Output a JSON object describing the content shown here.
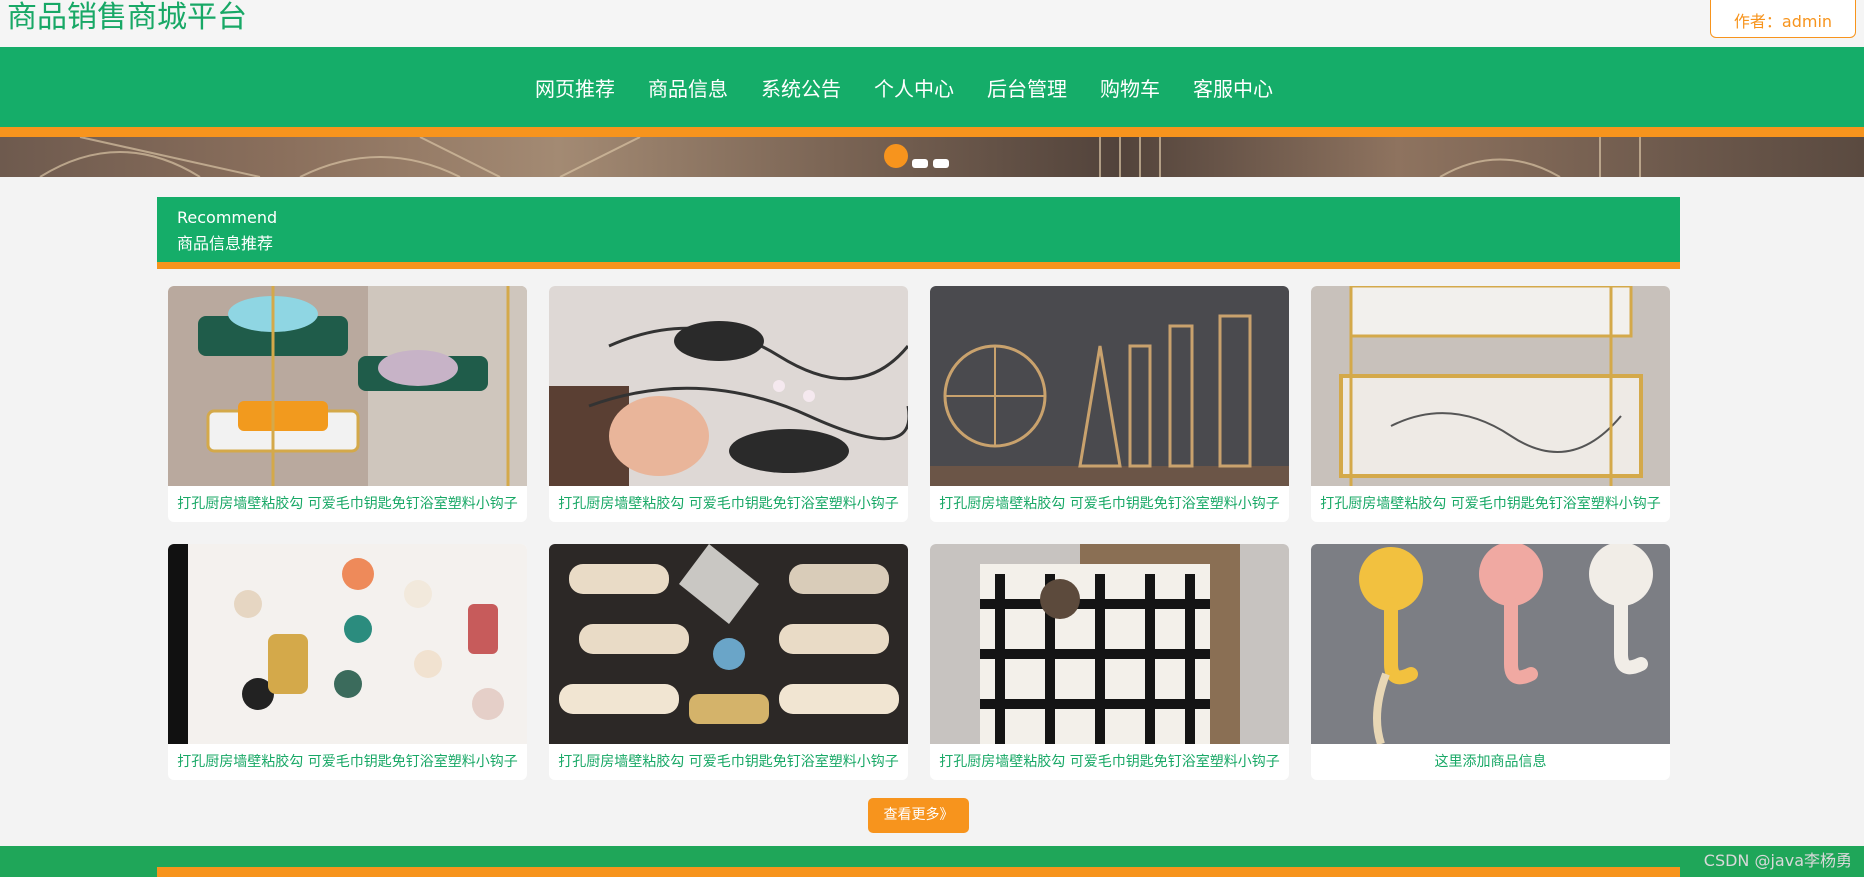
{
  "header": {
    "site_title": "商品销售商城平台",
    "author_label": "作者：admin"
  },
  "nav": {
    "items": [
      {
        "label": "网页推荐"
      },
      {
        "label": "商品信息"
      },
      {
        "label": "系统公告"
      },
      {
        "label": "个人中心"
      },
      {
        "label": "后台管理"
      },
      {
        "label": "购物车"
      },
      {
        "label": "客服中心"
      }
    ]
  },
  "banner": {
    "slides": 3,
    "active_index": 0
  },
  "recommend": {
    "title_en": "Recommend",
    "title_cn": "商品信息推荐",
    "products": [
      {
        "name": "打孔厨房墙壁粘胶勾 可爱毛巾钥匙免钉浴室塑料小钩子",
        "image": "soap-dish"
      },
      {
        "name": "打孔厨房墙壁粘胶勾 可爱毛巾钥匙免钉浴室塑料小钩子",
        "image": "zipper-bag"
      },
      {
        "name": "打孔厨房墙壁粘胶勾 可爱毛巾钥匙免钉浴室塑料小钩子",
        "image": "tower-models"
      },
      {
        "name": "打孔厨房墙壁粘胶勾 可爱毛巾钥匙免钉浴室塑料小钩子",
        "image": "marble-shelf"
      },
      {
        "name": "打孔厨房墙壁粘胶勾 可爱毛巾钥匙免钉浴室塑料小钩子",
        "image": "hair-clips"
      },
      {
        "name": "打孔厨房墙壁粘胶勾 可爱毛巾钥匙免钉浴室塑料小钩子",
        "image": "pearl-clips"
      },
      {
        "name": "打孔厨房墙壁粘胶勾 可爱毛巾钥匙免钉浴室塑料小钩子",
        "image": "plaid-bag"
      },
      {
        "name": "这里添加商品信息",
        "image": "wall-hooks"
      }
    ],
    "more_label": "查看更多》"
  },
  "footer": {
    "watermark": "CSDN @java李杨勇"
  },
  "colors": {
    "brand_green": "#15ad69",
    "accent_orange": "#f7941d",
    "caption_green": "#18a866"
  }
}
